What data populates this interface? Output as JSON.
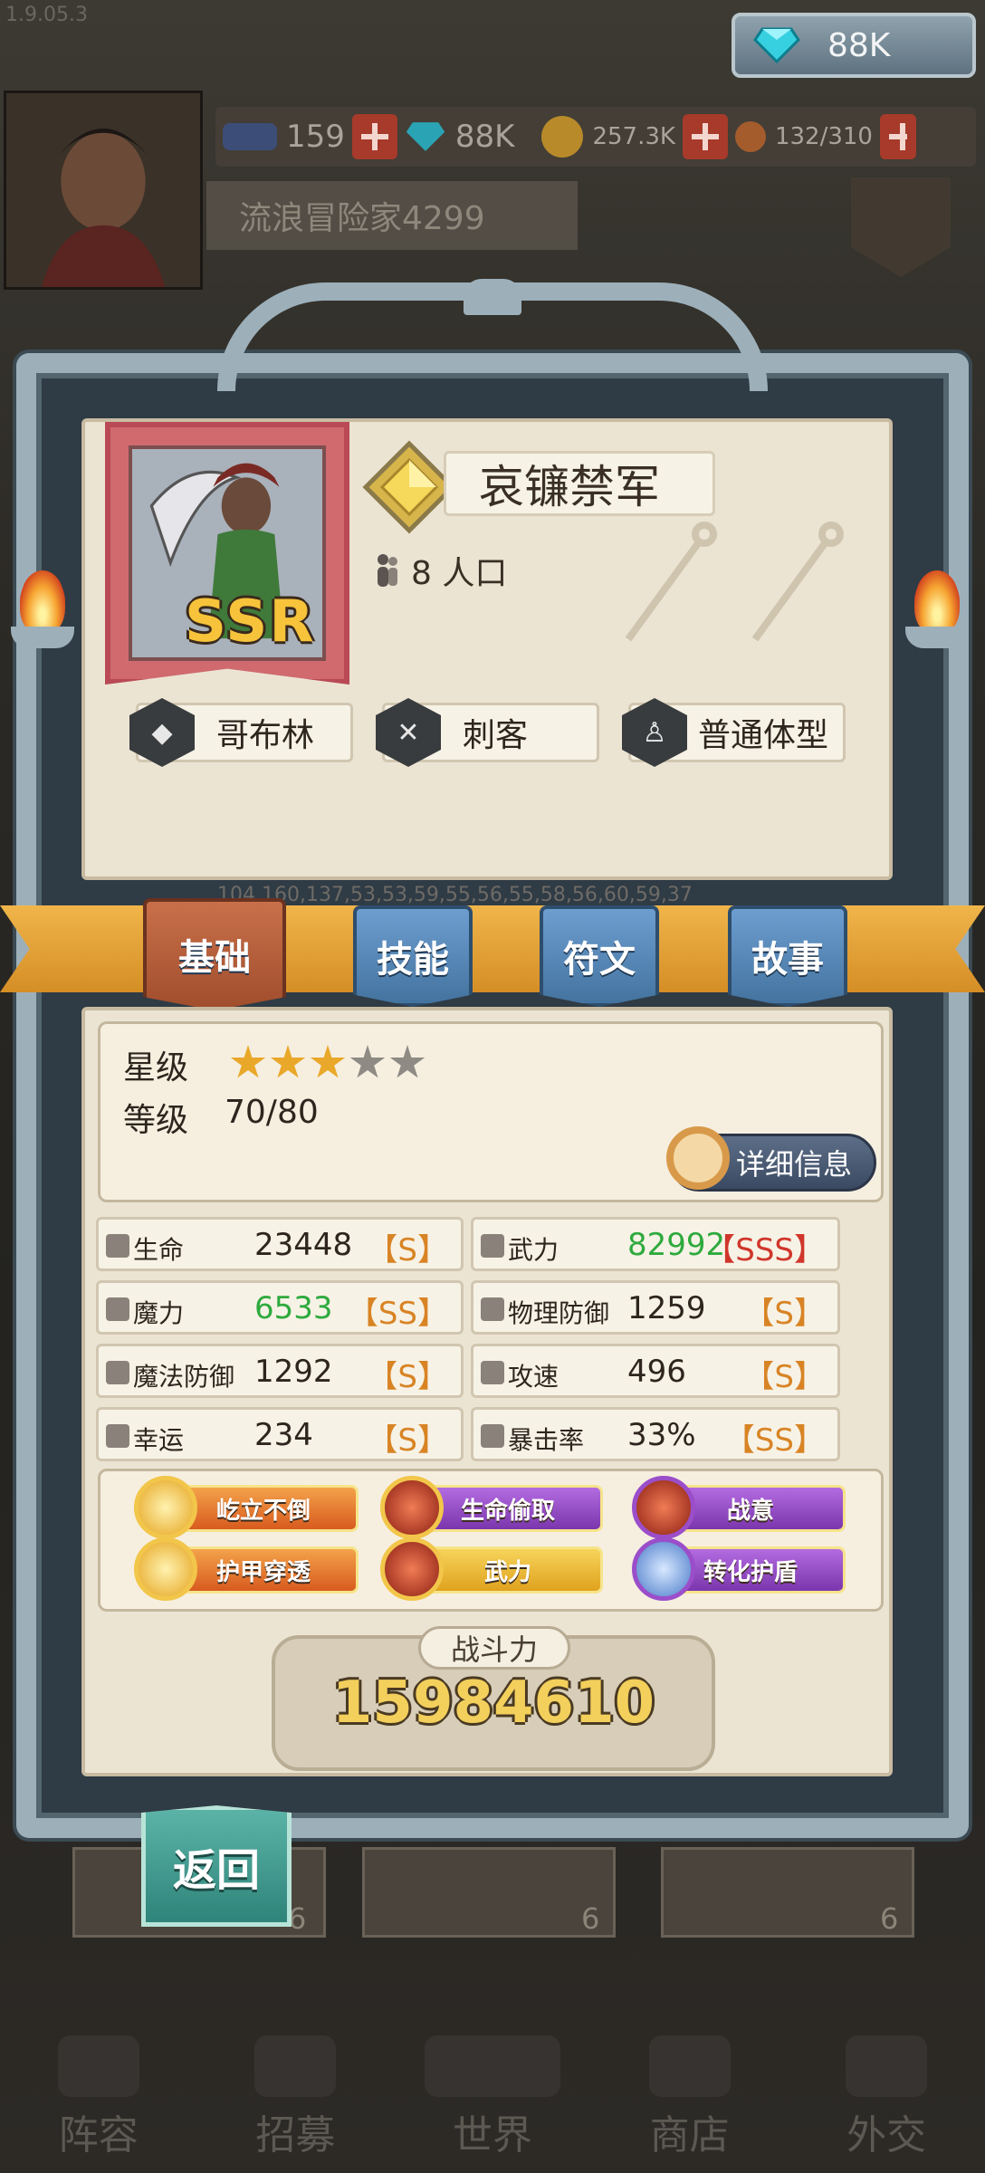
{
  "version": "1.9.05.3",
  "top_currency": {
    "value": "88K",
    "icon": "diamond-icon"
  },
  "player": {
    "name": "流浪冒险家4299"
  },
  "resources": {
    "stamina": "159",
    "diamonds": "88K",
    "gold": "257.3K",
    "food": "132/310"
  },
  "hero": {
    "name": "哀镰禁军",
    "rarity": "SSR",
    "population": "8 人口",
    "traits": [
      "哥布林",
      "刺客",
      "普通体型"
    ]
  },
  "faint_numbers": "104,160,137,53,53,59,55,56,55,58,56,60,59,37",
  "tabs": [
    "基础",
    "技能",
    "符文",
    "故事"
  ],
  "basic": {
    "star_label": "星级",
    "stars_filled": 3,
    "stars_total": 5,
    "level_label": "等级",
    "level_value": "70/80",
    "detail_button": "详细信息"
  },
  "stats": [
    {
      "name": "生命",
      "value": "23448",
      "grade": "【S】",
      "color": "normal"
    },
    {
      "name": "武力",
      "value": "82992",
      "grade": "【SSS】",
      "color": "green"
    },
    {
      "name": "魔力",
      "value": "6533",
      "grade": "【SS】",
      "color": "green"
    },
    {
      "name": "物理防御",
      "value": "1259",
      "grade": "【S】",
      "color": "normal"
    },
    {
      "name": "魔法防御",
      "value": "1292",
      "grade": "【S】",
      "color": "normal"
    },
    {
      "name": "攻速",
      "value": "496",
      "grade": "【S】",
      "color": "normal"
    },
    {
      "name": "幸运",
      "value": "234",
      "grade": "【S】",
      "color": "normal"
    },
    {
      "name": "暴击率",
      "value": "33%",
      "grade": "【SS】",
      "color": "normal"
    }
  ],
  "skills": [
    "屹立不倒",
    "生命偷取",
    "战意",
    "护甲穿透",
    "武力",
    "转化护盾"
  ],
  "power": {
    "label": "战斗力",
    "value": "15984610"
  },
  "back_button": "返回",
  "bg_card_counts": [
    "6",
    "6",
    "6"
  ],
  "nav": [
    "阵容",
    "招募",
    "世界",
    "商店",
    "外交"
  ],
  "colors": {
    "accent_gold": "#f0b54a",
    "frame": "#9db0ba",
    "tab_active": "#a14e2d",
    "tab": "#44739f",
    "grade_red": "#d0362b",
    "green_value": "#2eaa3e"
  }
}
